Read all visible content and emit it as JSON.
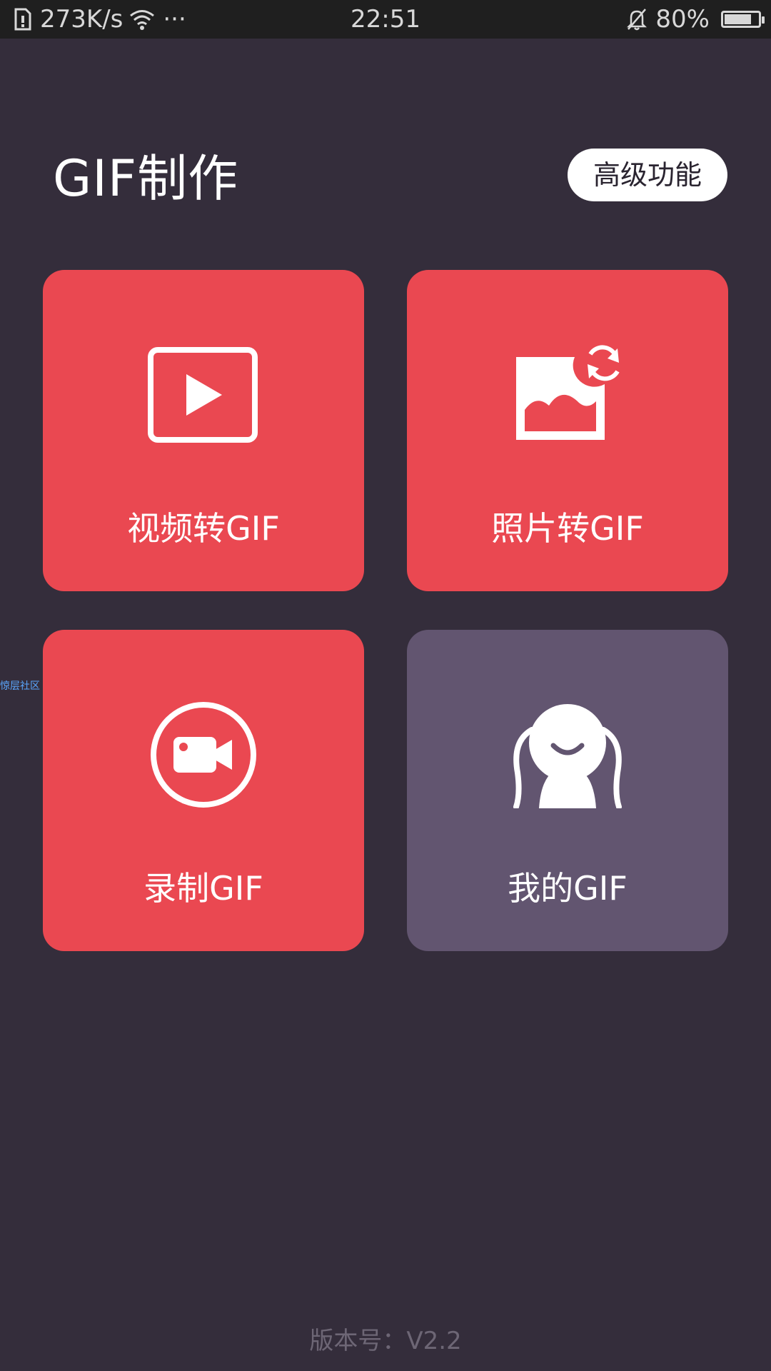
{
  "status_bar": {
    "network_speed": "273K/s",
    "more": "···",
    "time": "22:51",
    "battery_percent": "80%",
    "battery_level": 0.8
  },
  "header": {
    "title": "GIF制作",
    "advanced_button": "高级功能"
  },
  "tiles": [
    {
      "label": "视频转GIF",
      "icon": "video-play-icon",
      "color": "#ea4851"
    },
    {
      "label": "照片转GIF",
      "icon": "photo-convert-icon",
      "color": "#ea4851"
    },
    {
      "label": "录制GIF",
      "icon": "record-camera-icon",
      "color": "#ea4851"
    },
    {
      "label": "我的GIF",
      "icon": "mascot-icon",
      "color": "#625570"
    }
  ],
  "side_link": "惊层社区",
  "footer": {
    "version": "版本号：V2.2"
  },
  "colors": {
    "background": "#342d3b",
    "accent_red": "#ea4851",
    "purple_tile": "#625570"
  }
}
